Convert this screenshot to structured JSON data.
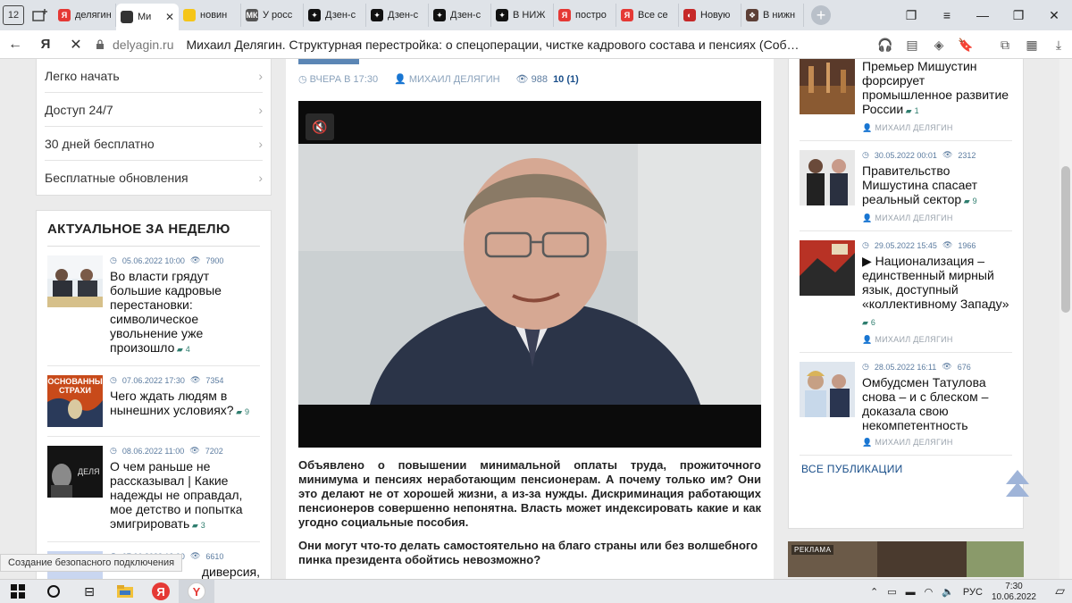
{
  "browser": {
    "tab_counter": "12",
    "tabs": [
      {
        "label": "делягин",
        "fav_color": "#e53935",
        "fav_text": "Я"
      },
      {
        "label": "Ми",
        "fav_color": "#333333",
        "fav_text": "",
        "active": true
      },
      {
        "label": "новин",
        "fav_color": "#f5c518",
        "fav_text": ""
      },
      {
        "label": "У росс",
        "fav_color": "#555555",
        "fav_text": "МК"
      },
      {
        "label": "Дзен-с",
        "fav_color": "#111111",
        "fav_text": "✦"
      },
      {
        "label": "Дзен-с",
        "fav_color": "#111111",
        "fav_text": "✦"
      },
      {
        "label": "Дзен-с",
        "fav_color": "#111111",
        "fav_text": "✦"
      },
      {
        "label": "В НИЖ",
        "fav_color": "#111111",
        "fav_text": "✦"
      },
      {
        "label": "постро",
        "fav_color": "#e53935",
        "fav_text": "Я"
      },
      {
        "label": "Все се",
        "fav_color": "#e53935",
        "fav_text": "Я"
      },
      {
        "label": "Новую",
        "fav_color": "#c62828",
        "fav_text": "◐"
      },
      {
        "label": "В нижн",
        "fav_color": "#5d4037",
        "fav_text": "❖"
      }
    ],
    "domain": "delyagin.ru",
    "page_title": "Михаил Делягин. Структурная перестройка: о спецоперации, чистке кадрового состава и пенсиях (Соб…"
  },
  "left_menu": {
    "items": [
      "Легко начать",
      "Доступ 24/7",
      "30 дней бесплатно",
      "Бесплатные обновления"
    ]
  },
  "week": {
    "heading": "АКТУАЛЬНОЕ ЗА НЕДЕЛЮ",
    "items": [
      {
        "date": "05.06.2022 10:00",
        "views": "7900",
        "title": "Во власти грядут большие кадровые перестановки: символическое увольнение уже произошло",
        "comments": "4"
      },
      {
        "date": "07.06.2022 17:30",
        "views": "7354",
        "title": "Чего ждать людям в нынешних условиях?",
        "comments": "9",
        "thumb_text": "ОСНОВАННЫ СТРАХИ"
      },
      {
        "date": "08.06.2022 11:00",
        "views": "7202",
        "title": "О чем раньше не рассказывал | Какие надежды не оправдал, мое детство и попытка эмигрировать",
        "comments": "3",
        "thumb_text": "ДЕЛЯ"
      },
      {
        "date": "07.06.2022 13:00",
        "views": "6610",
        "title": "диверсия,",
        "comments": ""
      }
    ]
  },
  "article": {
    "date": "ВЧЕРА В 17:30",
    "author": "МИХАИЛ ДЕЛЯГИН",
    "views": "988",
    "comments": "10 (1)",
    "para1": "Объявлено о повышении минимальной оплаты труда, прожиточного минимума и пенсиях неработающим пенсионерам. А почему только им? Они это делают не от хорошей жизни, а из-за нужды. Дискриминация работающих пенсионеров совершенно непонятна. Власть может индексировать какие и как угодно социальные пособия.",
    "para2": "Они могут что-то делать самостоятельно на благо страны или без волшебного пинка президента обойтись невозможно?"
  },
  "right": {
    "items": [
      {
        "date": "",
        "views": "",
        "title": "Премьер Мишустин форсирует промышленное развитие России",
        "comments": "1",
        "author": "МИХАИЛ ДЕЛЯГИН"
      },
      {
        "date": "30.05.2022 00:01",
        "views": "2312",
        "title": "Правительство Мишустина спасает реальный сектор",
        "comments": "9",
        "author": "МИХАИЛ ДЕЛЯГИН"
      },
      {
        "date": "29.05.2022 15:45",
        "views": "1966",
        "title": "▶ Национализация – единственный мирный язык, доступный «коллективному Западу»",
        "comments": "6",
        "author": "МИХАИЛ ДЕЛЯГИН"
      },
      {
        "date": "28.05.2022 16:11",
        "views": "676",
        "title": "Омбудсмен Татулова снова – и с блеском – доказала свою некомпетентность",
        "comments": "",
        "author": "МИХАИЛ ДЕЛЯГИН"
      }
    ],
    "all_pub": "ВСЕ ПУБЛИКАЦИИ",
    "ad_label": "РЕКЛАМА"
  },
  "status_text": "Создание безопасного подключения",
  "taskbar": {
    "lang": "РУС",
    "time": "7:30",
    "date": "10.06.2022"
  }
}
